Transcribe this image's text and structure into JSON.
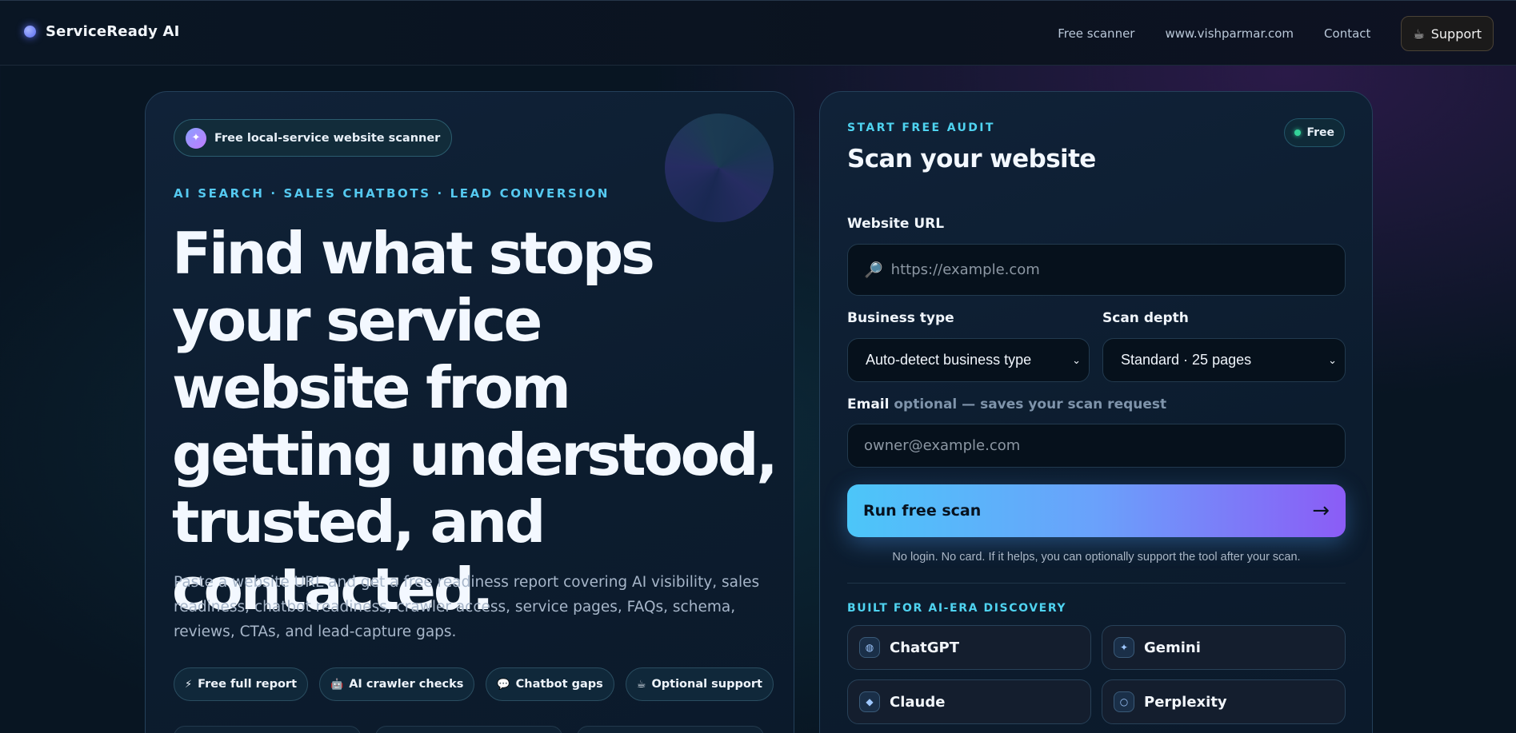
{
  "header": {
    "brand": "ServiceReady AI",
    "nav": [
      "Free scanner",
      "www.vishparmar.com",
      "Contact"
    ],
    "support_label": "Support",
    "support_icon": "coffee-icon"
  },
  "hero": {
    "pill_label": "Free local-service website scanner",
    "pill_icon": "sparkle-icon",
    "eyebrow": "AI SEARCH · SALES CHATBOTS · LEAD CONVERSION",
    "headline": "Find what stops your service website from getting understood, trusted, and contacted.",
    "lead": "Paste a website URL and get a free readiness report covering AI visibility, sales readiness, chatbot readiness, crawler access, service pages, FAQs, schema, reviews, CTAs, and lead-capture gaps.",
    "chips": [
      {
        "icon": "⚡",
        "label": "Free full report"
      },
      {
        "icon": "🤖",
        "label": "AI crawler checks"
      },
      {
        "icon": "💬",
        "label": "Chatbot gaps"
      },
      {
        "icon": "☕",
        "label": "Optional support"
      }
    ]
  },
  "scan_form": {
    "eyebrow": "START FREE AUDIT",
    "badge": "Free",
    "title": "Scan your website",
    "url_label": "Website URL",
    "url_placeholder": "https://example.com",
    "business_label": "Business type",
    "business_value": "Auto-detect business type",
    "depth_label": "Scan depth",
    "depth_value": "Standard · 25 pages",
    "email_label": "Email",
    "email_hint": "optional — saves your scan request",
    "email_placeholder": "owner@example.com",
    "cta_label": "Run free scan",
    "cta_arrow": "→",
    "note": "No login. No card. If it helps, you can optionally support the tool after your scan.",
    "discovery_eyebrow": "BUILT FOR AI-ERA DISCOVERY",
    "ai_platforms": [
      {
        "name": "ChatGPT",
        "icon": "◍"
      },
      {
        "name": "Gemini",
        "icon": "✦"
      },
      {
        "name": "Claude",
        "icon": "◆"
      },
      {
        "name": "Perplexity",
        "icon": "○"
      }
    ]
  }
}
